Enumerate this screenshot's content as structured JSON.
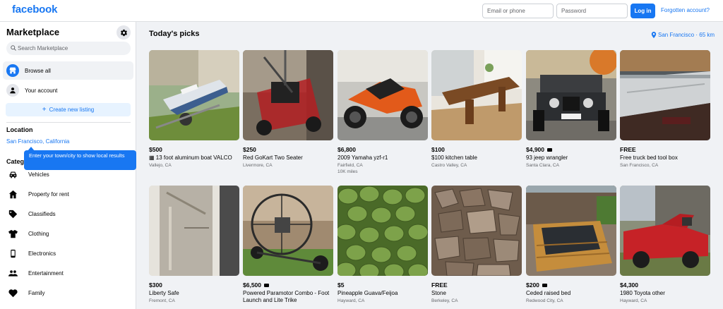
{
  "header": {
    "logo": "facebook",
    "email_placeholder": "Email or phone",
    "password_placeholder": "Password",
    "login_label": "Log in",
    "forgot_label": "Forgotten account?"
  },
  "sidebar": {
    "title": "Marketplace",
    "search_placeholder": "Search Marketplace",
    "nav": [
      {
        "label": "Browse all",
        "icon": "storefront-icon"
      },
      {
        "label": "Your account",
        "icon": "person-icon"
      }
    ],
    "create_label": "Create new listing",
    "location_title": "Location",
    "location_value": "San Francisco, California",
    "tooltip": "Enter your town/city to show local results",
    "categories_title": "Categories",
    "categories": [
      {
        "label": "Vehicles",
        "icon": "car-icon"
      },
      {
        "label": "Property for rent",
        "icon": "house-icon"
      },
      {
        "label": "Classifieds",
        "icon": "tag-icon"
      },
      {
        "label": "Clothing",
        "icon": "shirt-icon"
      },
      {
        "label": "Electronics",
        "icon": "phone-icon"
      },
      {
        "label": "Entertainment",
        "icon": "people-icon"
      },
      {
        "label": "Family",
        "icon": "heart-icon"
      }
    ]
  },
  "main": {
    "title": "Today's picks",
    "location": "San Francisco · 65 km",
    "listings": [
      {
        "price": "$500",
        "title": "13 foot aluminum boat VALCO",
        "location": "Vallejo, CA",
        "extra": "",
        "video": false,
        "image": "boat-photo"
      },
      {
        "price": "$250",
        "title": "Red GoKart Two Seater",
        "location": "Livermore, CA",
        "extra": "",
        "video": false,
        "image": "gokart-photo"
      },
      {
        "price": "$6,800",
        "title": "2009 Yamaha yzf-r1",
        "location": "Fairfield, CA",
        "extra": "10K miles",
        "video": false,
        "image": "motorcycle-photo"
      },
      {
        "price": "$100",
        "title": "$100 kitchen table",
        "location": "Castro Valley, CA",
        "extra": "",
        "video": false,
        "image": "table-photo"
      },
      {
        "price": "$4,900",
        "title": "93 jeep wrangler",
        "location": "Santa Clara, CA",
        "extra": "",
        "video": true,
        "image": "jeep-photo"
      },
      {
        "price": "FREE",
        "title": "Free truck bed tool box",
        "location": "San Francisco, CA",
        "extra": "",
        "video": false,
        "image": "toolbox-photo"
      },
      {
        "price": "$300",
        "title": "Liberty Safe",
        "location": "Fremont, CA",
        "extra": "",
        "video": false,
        "image": "safe-photo"
      },
      {
        "price": "$6,500",
        "title": "Powered Paramotor Combo - Foot Launch and Lite Trike",
        "location": "",
        "extra": "",
        "video": true,
        "image": "paramotor-photo"
      },
      {
        "price": "$5",
        "title": "Pineapple Guava/Feijoa",
        "location": "Hayward, CA",
        "extra": "",
        "video": false,
        "image": "guava-photo"
      },
      {
        "price": "FREE",
        "title": "Stone",
        "location": "Berkeley, CA",
        "extra": "",
        "video": false,
        "image": "stone-photo"
      },
      {
        "price": "$200",
        "title": "Ceded raised bed",
        "location": "Redwood City, CA",
        "extra": "",
        "video": true,
        "image": "raised-bed-photo"
      },
      {
        "price": "$4,300",
        "title": "1980 Toyota other",
        "location": "Hayward, CA",
        "extra": "",
        "video": false,
        "image": "toyota-truck-photo"
      }
    ]
  },
  "colors": {
    "brand": "#1877f2",
    "background": "#f0f2f5"
  }
}
